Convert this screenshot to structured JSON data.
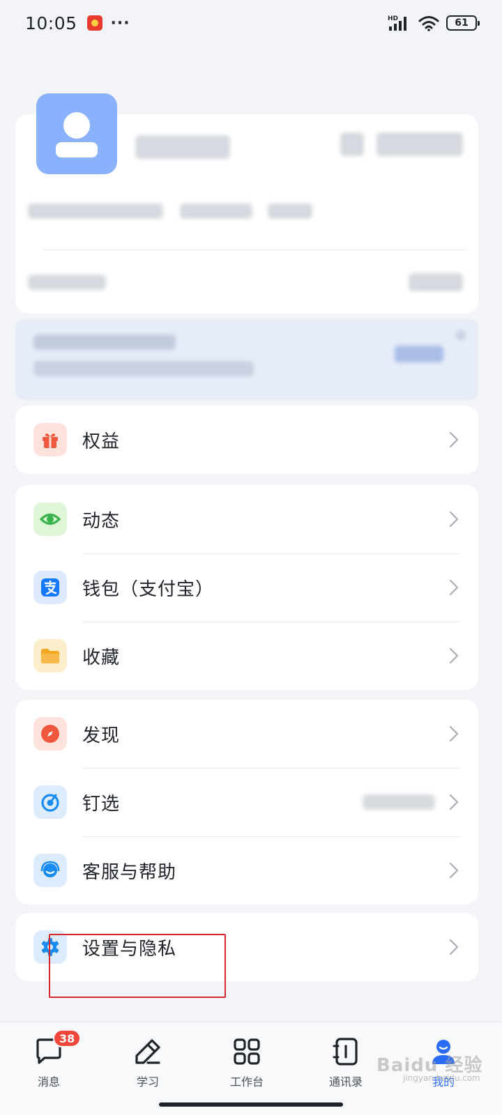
{
  "status_bar": {
    "time": "10:05",
    "more": "···",
    "network": "HD",
    "battery": "61"
  },
  "menu": {
    "group1": [
      {
        "label": "权益",
        "icon": "gift-icon",
        "icon_bg": "#fde3dc",
        "icon_color": "#f0583e"
      }
    ],
    "group2": [
      {
        "label": "动态",
        "icon": "eye-icon",
        "icon_bg": "#dff5d8",
        "icon_color": "#35b24a"
      },
      {
        "label": "钱包（支付宝）",
        "icon": "alipay-icon",
        "icon_bg": "#dde9fd",
        "icon_color": "#1677ff"
      },
      {
        "label": "收藏",
        "icon": "folder-icon",
        "icon_bg": "#fdeecb",
        "icon_color": "#f5a623"
      }
    ],
    "group3": [
      {
        "label": "发现",
        "icon": "compass-icon",
        "icon_bg": "#fde3dc",
        "icon_color": "#f0583e"
      },
      {
        "label": "钉选",
        "icon": "pin-target-icon",
        "icon_bg": "#dcecfc",
        "icon_color": "#1a8cf0"
      },
      {
        "label": "客服与帮助",
        "icon": "headset-icon",
        "icon_bg": "#dcecfc",
        "icon_color": "#1a8cf0"
      }
    ],
    "group4": [
      {
        "label": "设置与隐私",
        "icon": "gear-icon",
        "icon_bg": "#dcecfc",
        "icon_color": "#1a8cf0"
      }
    ]
  },
  "tabs": [
    {
      "label": "消息",
      "icon": "message-icon",
      "badge": "38",
      "active": false
    },
    {
      "label": "学习",
      "icon": "pencil-icon",
      "active": false
    },
    {
      "label": "工作台",
      "icon": "grid-icon",
      "active": false
    },
    {
      "label": "通讯录",
      "icon": "contacts-icon",
      "active": false
    },
    {
      "label": "我的",
      "icon": "profile-icon",
      "active": true
    }
  ],
  "colors": {
    "accent": "#2b6cf6",
    "highlight": "#d8262e",
    "badge": "#f0473a"
  },
  "watermark": {
    "brand": "Baidu 经验",
    "url": "jingyan.baidu.com"
  }
}
